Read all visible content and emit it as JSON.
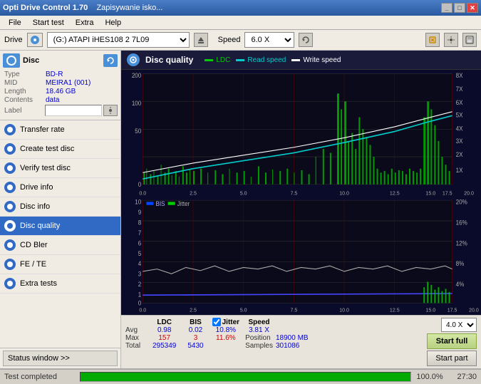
{
  "window": {
    "title": "Opti Drive Control 1.70",
    "subtitle": "Zapisywanie isko..."
  },
  "menu": {
    "items": [
      "File",
      "Start test",
      "Extra",
      "Help"
    ]
  },
  "drive": {
    "label": "Drive",
    "select_value": "(G:) ATAPI iHES108  2 7L09",
    "speed_label": "Speed",
    "speed_value": "6.0 X"
  },
  "disc": {
    "title": "Disc",
    "type_label": "Type",
    "type_value": "BD-R",
    "mid_label": "MID",
    "mid_value": "MEIRA1 (001)",
    "length_label": "Length",
    "length_value": "18.46 GB",
    "contents_label": "Contents",
    "contents_value": "data",
    "label_label": "Label"
  },
  "sidebar": {
    "items": [
      {
        "id": "transfer-rate",
        "label": "Transfer rate"
      },
      {
        "id": "create-test-disc",
        "label": "Create test disc"
      },
      {
        "id": "verify-test-disc",
        "label": "Verify test disc"
      },
      {
        "id": "drive-info",
        "label": "Drive info"
      },
      {
        "id": "disc-info",
        "label": "Disc info"
      },
      {
        "id": "disc-quality",
        "label": "Disc quality",
        "active": true
      },
      {
        "id": "cd-bler",
        "label": "CD Bler"
      },
      {
        "id": "fe-te",
        "label": "FE / TE"
      },
      {
        "id": "extra-tests",
        "label": "Extra tests"
      }
    ]
  },
  "chart": {
    "title": "Disc quality",
    "legend": [
      {
        "label": "LDC",
        "color": "#00cc00"
      },
      {
        "label": "Read speed",
        "color": "#00cccc"
      },
      {
        "label": "Write speed",
        "color": "#ffffff"
      }
    ],
    "legend2": [
      {
        "label": "BIS",
        "color": "#0044ff"
      },
      {
        "label": "Jitter",
        "color": "#00cc00"
      }
    ],
    "x_max": "25.0 GB",
    "y1_max": "200",
    "y2_max": "10",
    "y1_right_labels": [
      "8X",
      "7X",
      "6X",
      "5X",
      "4X",
      "3X",
      "2X",
      "1X"
    ],
    "y2_right_labels": [
      "20%",
      "16%",
      "12%",
      "8%",
      "4%"
    ]
  },
  "stats": {
    "col_headers": [
      "LDC",
      "BIS",
      "Jitter",
      "Speed",
      ""
    ],
    "avg_label": "Avg",
    "avg_ldc": "0.98",
    "avg_bis": "0.02",
    "avg_jitter": "10.8%",
    "avg_speed": "3.81 X",
    "max_label": "Max",
    "max_ldc": "157",
    "max_bis": "3",
    "max_jitter": "11.6%",
    "position_label": "Position",
    "position_value": "18900 MB",
    "total_label": "Total",
    "total_ldc": "295349",
    "total_bis": "5430",
    "samples_label": "Samples",
    "samples_value": "301086",
    "speed_select": "4.0 X",
    "btn_start_full": "Start full",
    "btn_start_part": "Start part"
  },
  "status": {
    "window_btn": "Status window >>",
    "test_completed": "Test completed",
    "progress": "100.0%",
    "time": "27:30"
  }
}
